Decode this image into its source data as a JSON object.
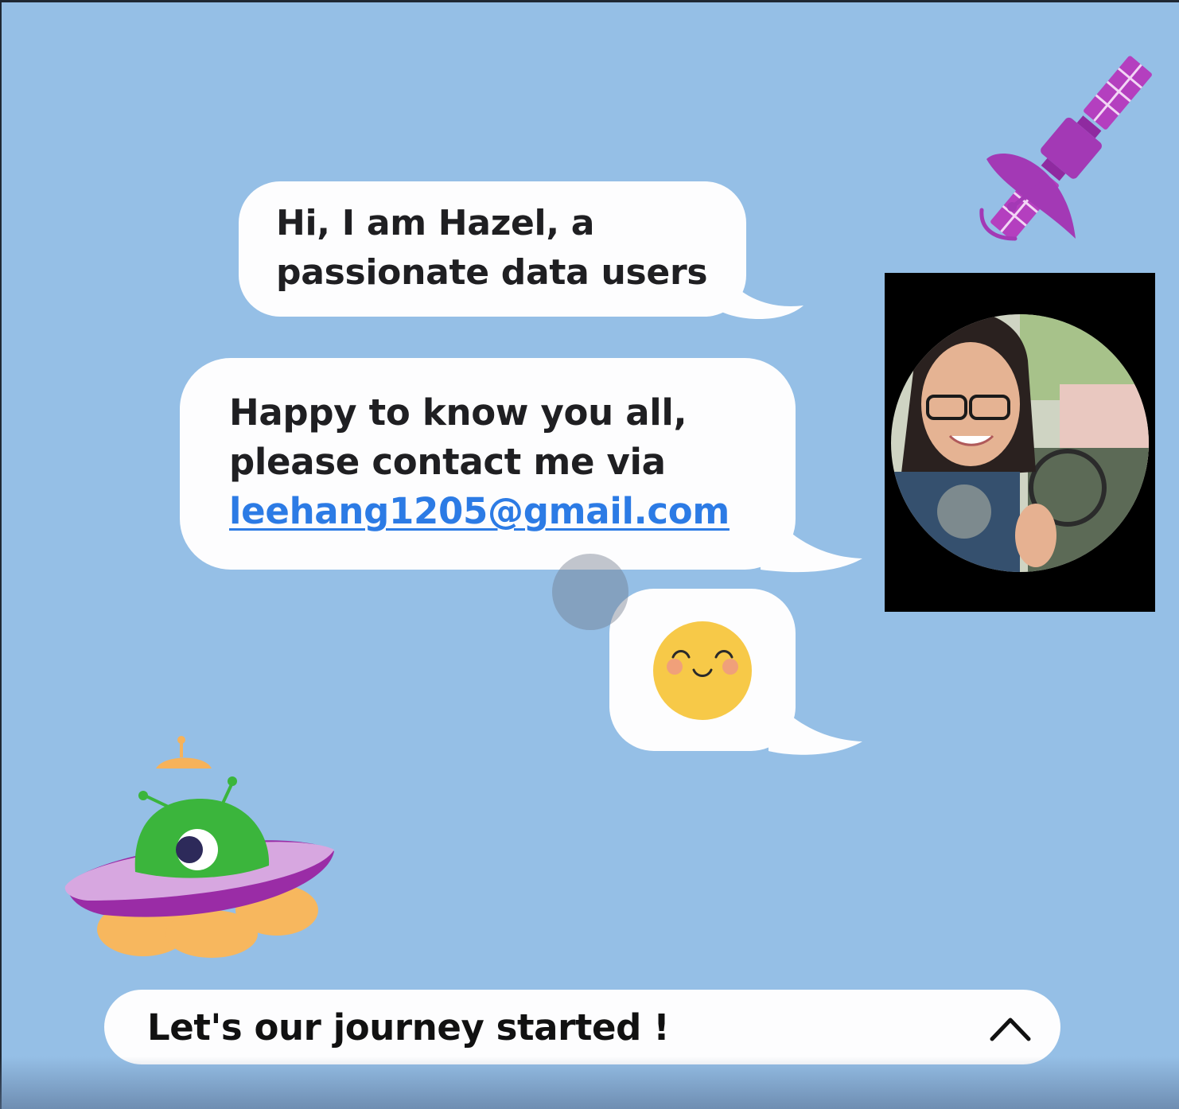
{
  "messages": {
    "intro": "Hi, I am Hazel, a\npassionate data users",
    "contact_text": "Happy to know you all,\nplease contact me via\n",
    "email": "leehang1205@gmail.com"
  },
  "icons": {
    "reaction": "smiley-face-icon",
    "decor_top_right": "satellite-icon",
    "decor_bottom_left": "alien-ufo-icon",
    "toggle": "chevron-up-icon"
  },
  "footer": {
    "label": "Let's our journey started !"
  },
  "colors": {
    "background": "#95bfe6",
    "bubble": "#fdfdfe",
    "link": "#2c7be5",
    "satellite": "#a339b5",
    "alien": "#3bb53c",
    "smiley": "#f7c948"
  }
}
